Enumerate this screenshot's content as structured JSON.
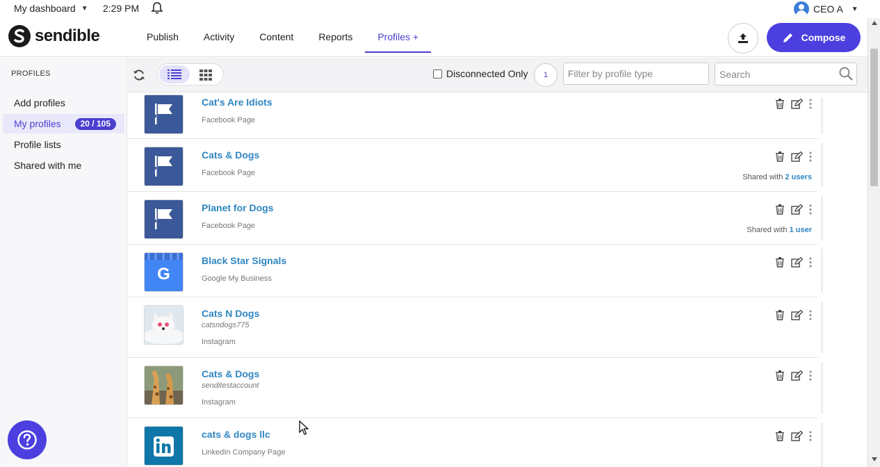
{
  "topbar": {
    "dashboard_label": "My dashboard",
    "time": "2:29 PM",
    "user_name": "CEO A"
  },
  "brand": {
    "name": "sendible"
  },
  "nav": {
    "items": [
      {
        "label": "Publish"
      },
      {
        "label": "Activity"
      },
      {
        "label": "Content"
      },
      {
        "label": "Reports"
      },
      {
        "label": "Profiles +"
      }
    ],
    "active": "Profiles +",
    "compose_label": "Compose"
  },
  "sidebar": {
    "title": "PROFILES",
    "items": [
      {
        "label": "Add profiles"
      },
      {
        "label": "My profiles",
        "badge": "20 / 105",
        "active": true
      },
      {
        "label": "Profile lists"
      },
      {
        "label": "Shared with me"
      }
    ]
  },
  "toolbar": {
    "disconnected_label": "Disconnected Only",
    "count": "1",
    "filter_placeholder": "Filter by profile type",
    "search_placeholder": "Search"
  },
  "profiles": [
    {
      "name": "Cat's Are Idiots",
      "handle": "",
      "type": "Facebook Page",
      "shared_prefix": "",
      "shared_link": "",
      "icon": "facebook-flag"
    },
    {
      "name": "Cats & Dogs",
      "handle": "",
      "type": "Facebook Page",
      "shared_prefix": "Shared with ",
      "shared_link": "2 users",
      "icon": "facebook-flag"
    },
    {
      "name": "Planet for Dogs",
      "handle": "",
      "type": "Facebook Page",
      "shared_prefix": "Shared with ",
      "shared_link": "1 user",
      "icon": "facebook-flag"
    },
    {
      "name": "Black Star Signals",
      "handle": "",
      "type": "Google My Business",
      "shared_prefix": "",
      "shared_link": "",
      "icon": "google-my-business"
    },
    {
      "name": "Cats N Dogs",
      "handle": "catsndogs775",
      "type": "Instagram",
      "shared_prefix": "",
      "shared_link": "",
      "icon": "instagram-photo"
    },
    {
      "name": "Cats & Dogs",
      "handle": "senditestaccount",
      "type": "Instagram",
      "shared_prefix": "",
      "shared_link": "",
      "icon": "instagram-photo-giraffe"
    },
    {
      "name": "cats & dogs llc",
      "handle": "",
      "type": "LinkedIn Company Page",
      "shared_prefix": "",
      "shared_link": "",
      "icon": "linkedin"
    }
  ],
  "colors": {
    "accent": "#4b3fe0",
    "link": "#2f86c1",
    "facebook": "#3b5998",
    "linkedin": "#0e76a8",
    "google": "#4285f4"
  }
}
